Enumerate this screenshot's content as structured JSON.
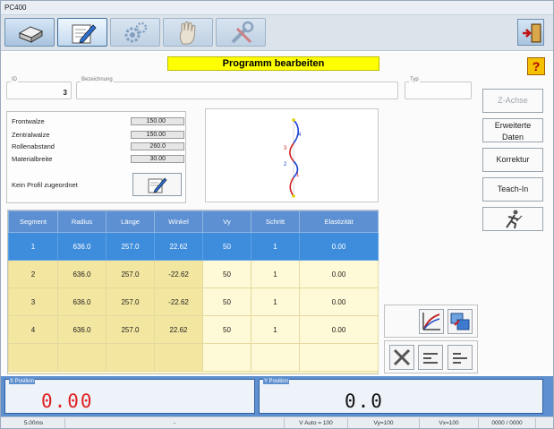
{
  "window": {
    "title": "PC400"
  },
  "toolbar": {
    "buttons": [
      {
        "icon": "cleaning-roller-icon"
      },
      {
        "icon": "edit-pencil-icon"
      },
      {
        "icon": "gears-icon"
      },
      {
        "icon": "hand-icon"
      },
      {
        "icon": "tools-icon"
      }
    ],
    "exit_icon": "exit-door-icon"
  },
  "header": {
    "title": "Programm bearbeiten",
    "help": "?"
  },
  "fields": {
    "id": {
      "label": "ID",
      "value": "3"
    },
    "bezeichnung": {
      "label": "Bezeichnung",
      "value": ""
    },
    "typ": {
      "label": "Typ",
      "value": ""
    }
  },
  "right_buttons": {
    "z_achse": "Z-Achse",
    "erweiterte_1": "Erweiterte",
    "erweiterte_2": "Daten",
    "korrektur": "Korrektur",
    "teach_in": "Teach-In"
  },
  "profile": {
    "rows": [
      {
        "label": "Frontwalze",
        "value": "150.00"
      },
      {
        "label": "Zentralwalze",
        "value": "150.00"
      },
      {
        "label": "Rollenabstand",
        "value": "260.0"
      },
      {
        "label": "Materialbreite",
        "value": "30.00"
      }
    ],
    "no_profile": "Kein Profil zugeordnet"
  },
  "preview": {
    "labels": [
      "4",
      "3",
      "2",
      "1"
    ]
  },
  "table": {
    "headers": [
      "Segment",
      "Radius",
      "Länge",
      "Winkel",
      "Vy",
      "Schritt",
      "Elastizität"
    ],
    "rows": [
      [
        "1",
        "636.0",
        "257.0",
        "22.62",
        "50",
        "1",
        "0.00"
      ],
      [
        "2",
        "636.0",
        "257.0",
        "-22.62",
        "50",
        "1",
        "0.00"
      ],
      [
        "3",
        "636.0",
        "257.0",
        "-22.62",
        "50",
        "1",
        "0.00"
      ],
      [
        "4",
        "636.0",
        "257.0",
        "22.62",
        "50",
        "1",
        "0.00"
      ]
    ],
    "selected_row": 0
  },
  "positions": {
    "x_label": "X Position",
    "x_value": "0.00",
    "y_label": "Y Position",
    "y_value": "0.0",
    "x_color": "#e02020",
    "y_color": "#111111"
  },
  "status": {
    "time": "5.00ms",
    "dash": "-",
    "v_auto": "V Auto = 100",
    "vy": "Vy=100",
    "vx": "Vx=100",
    "counter": "0000 / 0000"
  }
}
